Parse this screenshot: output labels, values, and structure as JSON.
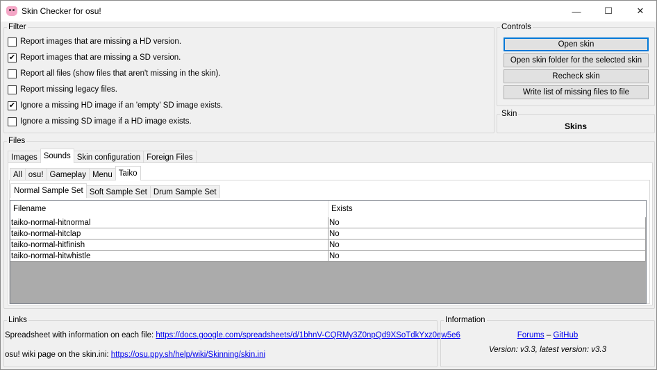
{
  "window": {
    "title": "Skin Checker for osu!",
    "controls": [
      "—",
      "☐",
      "✕"
    ]
  },
  "filter": {
    "label": "Filter",
    "options": [
      {
        "label": "Report images that are missing a HD version.",
        "checked": false
      },
      {
        "label": "Report images that are missing a SD version.",
        "checked": true
      },
      {
        "label": "Report all files (show files that aren't missing in the skin).",
        "checked": false
      },
      {
        "label": "Report missing legacy files.",
        "checked": false
      },
      {
        "label": "Ignore a missing HD image if an 'empty' SD image exists.",
        "checked": true
      },
      {
        "label": "Ignore a missing SD image if a HD image exists.",
        "checked": false
      }
    ]
  },
  "controls": {
    "label": "Controls",
    "open_skin": "Open skin",
    "open_folder": "Open skin folder for the selected skin",
    "recheck": "Recheck skin",
    "write_list": "Write list of missing files to file"
  },
  "skin": {
    "label": "Skin",
    "value": "Skins"
  },
  "files": {
    "label": "Files",
    "tabs": [
      "Images",
      "Sounds",
      "Skin configuration",
      "Foreign Files"
    ],
    "subtabs": [
      "All",
      "osu!",
      "Gameplay",
      "Menu",
      "Taiko"
    ],
    "sampletabs": [
      "Normal Sample Set",
      "Soft Sample Set",
      "Drum Sample Set"
    ],
    "columns": [
      "Filename",
      "Exists"
    ],
    "rows": [
      [
        "taiko-normal-hitnormal",
        "No"
      ],
      [
        "taiko-normal-hitclap",
        "No"
      ],
      [
        "taiko-normal-hitfinish",
        "No"
      ],
      [
        "taiko-normal-hitwhistle",
        "No"
      ]
    ]
  },
  "links": {
    "label": "Links",
    "sheet_text": "Spreadsheet with information on each file: ",
    "sheet_url": "https://docs.google.com/spreadsheets/d/1bhnV-CQRMy3Z0npQd9XSoTdkYxz0ew5e6",
    "wiki_text": "osu! wiki page on the skin.ini: ",
    "wiki_url": "https://osu.ppy.sh/help/wiki/Skinning/skin.ini"
  },
  "information": {
    "label": "Information",
    "forums": "Forums",
    "sep": " – ",
    "github": "GitHub",
    "version": "Version: v3.3, latest version: v3.3"
  }
}
